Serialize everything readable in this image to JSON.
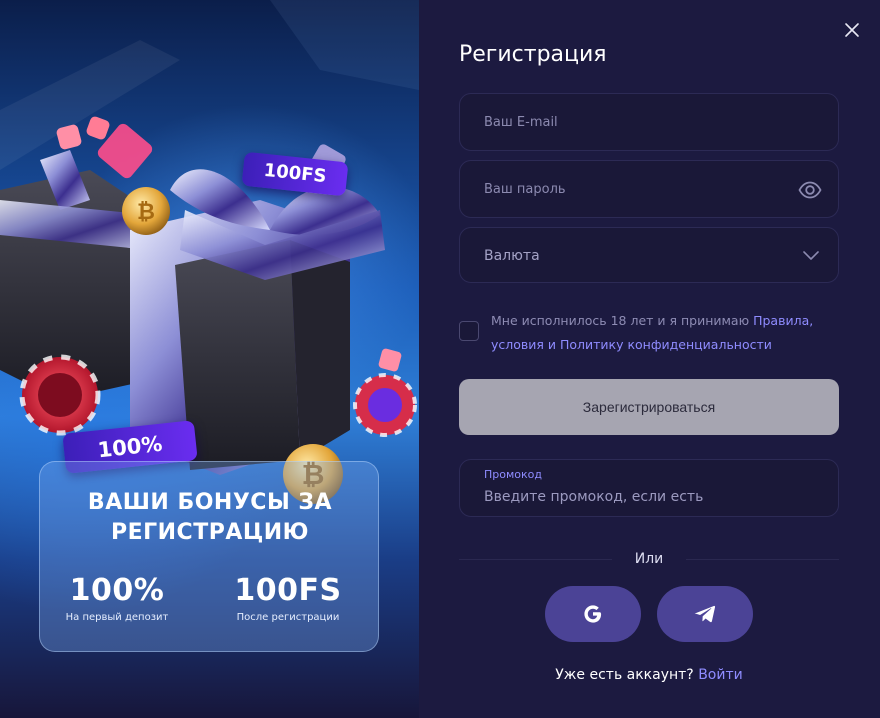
{
  "promo": {
    "tag_fs": "100FS",
    "tag_percent": "100%",
    "bonus_title": "ВАШИ БОНУСЫ ЗА РЕГИСТРАЦИЮ",
    "stats": [
      {
        "value": "100%",
        "caption": "На первый депозит"
      },
      {
        "value": "100FS",
        "caption": "После регистрации"
      }
    ]
  },
  "form": {
    "title": "Регистрация",
    "email_placeholder": "Ваш E-mail",
    "password_placeholder": "Ваш пароль",
    "currency_placeholder": "Валюта",
    "agree_text": "Мне исполнилось 18 лет и я принимаю ",
    "agree_link": "Правила, условия и Политику конфиденциальности",
    "agree_checked": false,
    "register_button": "Зарегистрироваться",
    "promo_label": "Промокод",
    "promo_placeholder": "Введите промокод, если есть",
    "or_text": "Или",
    "login_prompt": "Уже есть аккаунт?",
    "login_link": "Войти"
  },
  "icons": {
    "close": "close-icon",
    "eye": "eye-icon",
    "chevron": "chevron-down-icon",
    "google": "google-icon",
    "telegram": "telegram-icon"
  },
  "colors": {
    "panel_bg": "#1c1a40",
    "accent": "#8f8cff",
    "social_button": "#4b4396",
    "register_button_disabled": "#a6a5b1"
  }
}
